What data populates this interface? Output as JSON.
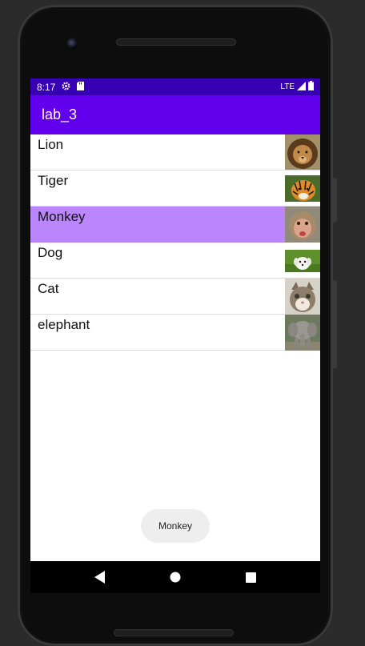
{
  "status_bar": {
    "time": "8:17",
    "icons": [
      "gear-icon",
      "sd-card-icon"
    ],
    "network": "LTE",
    "right_icons": [
      "signal-icon",
      "battery-icon"
    ]
  },
  "app_bar": {
    "title": "lab_3"
  },
  "list": {
    "items": [
      {
        "label": "Lion",
        "image": "lion-image",
        "selected": false
      },
      {
        "label": "Tiger",
        "image": "tiger-image",
        "selected": false
      },
      {
        "label": "Monkey",
        "image": "monkey-image",
        "selected": true
      },
      {
        "label": "Dog",
        "image": "dog-image",
        "selected": false
      },
      {
        "label": "Cat",
        "image": "cat-image",
        "selected": false
      },
      {
        "label": "elephant",
        "image": "elephant-image",
        "selected": false
      }
    ]
  },
  "toast": {
    "text": "Monkey"
  },
  "nav_bar": {
    "icons": [
      "back-icon",
      "home-icon",
      "recents-icon"
    ]
  },
  "colors": {
    "status_bar": "#3700b3",
    "app_bar": "#6200ee",
    "selected_row": "#bb86fc"
  }
}
